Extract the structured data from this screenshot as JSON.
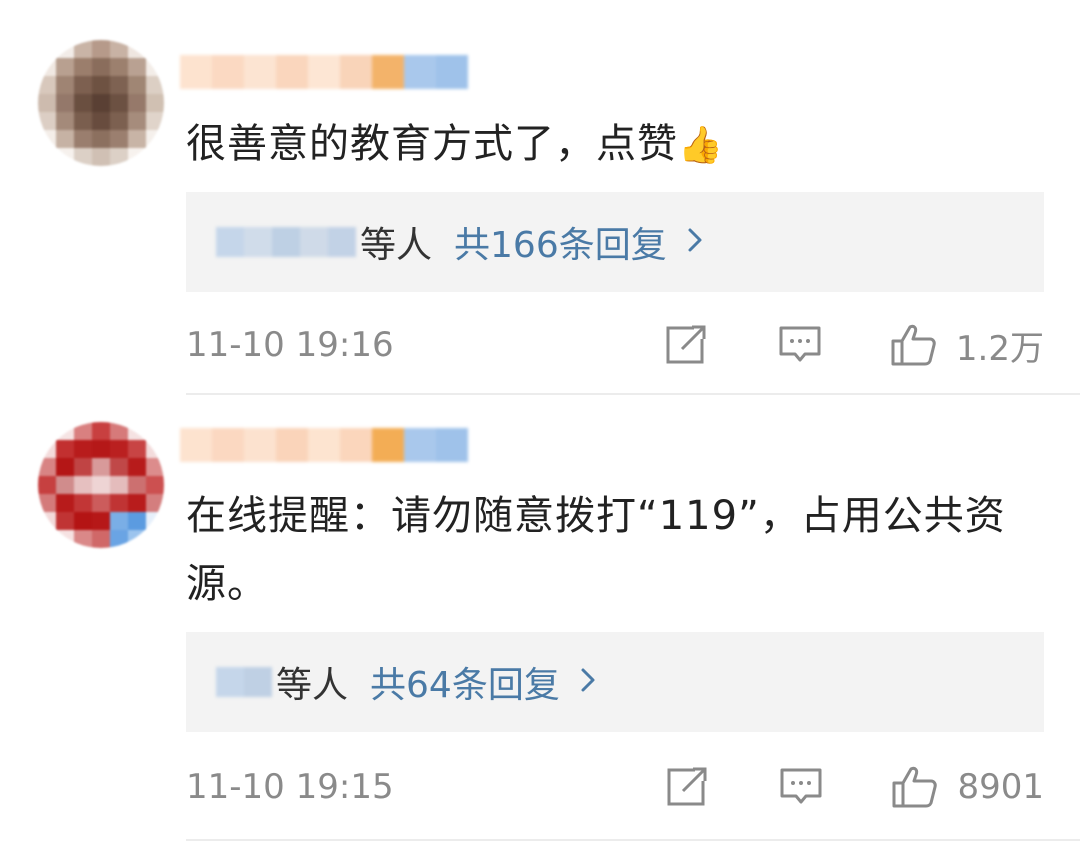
{
  "comments": [
    {
      "text": "很善意的教育方式了，点赞",
      "emoji": "👍",
      "reply_prefix": "等人",
      "reply_count_label": "共166条回复",
      "time": "11-10 19:16",
      "likes": "1.2万"
    },
    {
      "text": "在线提醒：请勿随意拨打“119”，占用公共资源。",
      "reply_prefix": "等人",
      "reply_count_label": "共64条回复",
      "time": "11-10 19:15",
      "likes": "8901"
    }
  ],
  "icons": {
    "share": "share-icon",
    "comment": "comment-icon",
    "like": "like-icon",
    "chevron": "chevron-right-icon"
  },
  "colors": {
    "link": "#4a7aa6",
    "meta": "#8a8a8a",
    "reply_bg": "#f3f3f3"
  }
}
